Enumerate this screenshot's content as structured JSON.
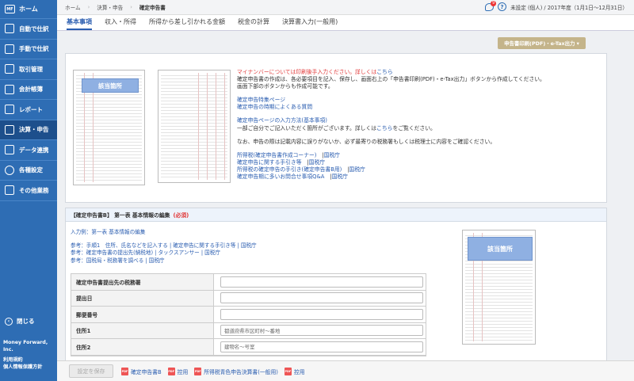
{
  "sidebar": {
    "home": "ホーム",
    "items": [
      {
        "label": "自動で仕訳"
      },
      {
        "label": "手動で仕訳"
      },
      {
        "label": "取引管理"
      },
      {
        "label": "会計帳簿"
      },
      {
        "label": "レポート"
      },
      {
        "label": "決算・申告"
      },
      {
        "label": "データ連携"
      },
      {
        "label": "各種設定"
      },
      {
        "label": "その他業務"
      }
    ],
    "close": "閉じる",
    "company": "Money Forward, Inc.",
    "terms": "利用規約",
    "privacy": "個人情報保護方針"
  },
  "topbar": {
    "breadcrumb": [
      "ホーム",
      "決算・申告",
      "確定申告書"
    ],
    "notification_count": "9",
    "user_info": "未設定 (個人) / 2017年度（1月1日〜12月31日）"
  },
  "tabs": [
    "基本事項",
    "収入・所得",
    "所得から差し引かれる金額",
    "税金の計算",
    "決算書入力(一般用)"
  ],
  "print_button": "申告書印刷(PDF)・e-Tax出力",
  "info": {
    "mynumber": "マイナンバーについては印刷後手入力ください。詳しくは",
    "mynumber_link": "こちら",
    "line1": "確定申告書の作成は、各必要項目を記入、保存し、画面右上の「申告書印刷(PDF)・e-Tax出力」ボタンから作成してください。",
    "line2": "画面下部のボタンからも作成可能です。",
    "link1": "確定申告特集ページ",
    "link2": "確定申告の時期によくある質問",
    "link3": "確定申告ページの入力方法(基本事項)",
    "line3a": "一部ご自分でご記入いただく箇所がございます。詳しくは",
    "line3_link": "こちら",
    "line3b": "をご覧ください。",
    "line4": "なお、申告の際は記載内容に誤りがないか、必ず最寄りの税務署もしくは税理士に内容をご確認ください。",
    "refs": [
      {
        "text": "所得税(確定申告書作成コーナー)",
        "src": "国税庁"
      },
      {
        "text": "確定申告に関する手引き等",
        "src": "国税庁"
      },
      {
        "text": "所得税の確定申告の手引き(確定申告書B用)",
        "src": "国税庁"
      },
      {
        "text": "確定申告期に多いお問合せ事項Q&A",
        "src": "国税庁"
      }
    ],
    "highlight": "該当箇所"
  },
  "form_section": {
    "title": "【確定申告書B】 第一表 基本情報の編集",
    "required": "(必須)",
    "example": "入力例：第一表 基本情報の編集",
    "ref1": "参考：手順1　住所、氏名などを記入する | 確定申告に関する手引き等 | 国税庁",
    "ref2": "参考：確定申告書の提出先(納税地) | タックスアンサー | 国税庁",
    "ref3": "参考：国税局・税務署を調べる | 国税庁",
    "highlight": "該当箇所",
    "rows": [
      {
        "label": "確定申告書提出先の税務署",
        "placeholder": ""
      },
      {
        "label": "提出日",
        "placeholder": ""
      },
      {
        "label": "郵便番号",
        "placeholder": ""
      },
      {
        "label": "住所1",
        "placeholder": "都道府県市区町村〜番地"
      },
      {
        "label": "住所2",
        "placeholder": "建物名〜号室"
      }
    ]
  },
  "bottombar": {
    "save": "設定を保存",
    "links": [
      "確定申告書B",
      "控用",
      "所得税青色申告決算書(一般用)",
      "控用"
    ]
  }
}
